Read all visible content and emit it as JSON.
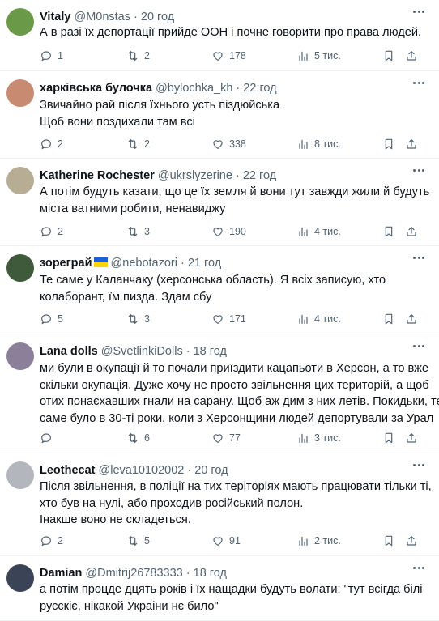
{
  "posts": [
    {
      "name": "Vitaly",
      "handle": "@M0nstas",
      "time": "20 год",
      "lines": [
        "А в разі їх депортації прийде ООН і почне говорити про права людей."
      ],
      "replies": "1",
      "reposts": "2",
      "likes": "178",
      "views": "5 тис.",
      "avatar_color": "#6a9a48"
    },
    {
      "name": "харківська булочка",
      "handle": "@bylochka_kh",
      "time": "22 год",
      "lines": [
        "Звичайно рай після їхнього усть піздюйська",
        "Щоб вони поздихали там всі"
      ],
      "replies": "2",
      "reposts": "2",
      "likes": "338",
      "views": "8 тис.",
      "avatar_color": "#c98a72"
    },
    {
      "name": "Katherine Rochester",
      "handle": "@ukrslyzerine",
      "time": "22 год",
      "lines": [
        "А потім будуть казати, що це їх земля й вони тут завжди жили й будуть",
        "міста ватними робити, ненавиджу"
      ],
      "replies": "2",
      "reposts": "3",
      "likes": "190",
      "views": "4 тис.",
      "avatar_color": "#b7ad95"
    },
    {
      "name": "зореграй",
      "handle": "@nebotazori",
      "time": "21 год",
      "lines": [
        "Те саме у Каланчаку (херсонська область). Я всіх записую, хто",
        "колаборант, їм пизда. Здам сбу"
      ],
      "replies": "5",
      "reposts": "3",
      "likes": "171",
      "views": "4 тис.",
      "avatar_color": "#3f5a3a",
      "flag": [
        "#1f5fd6",
        "#ffd400"
      ]
    },
    {
      "name": "Lana dolls",
      "handle": "@SvetlinkiDolls",
      "time": "18 год",
      "lines": [
        "ми були в окупації й то почали приїздити кацапьоти в Херсон, а то вже",
        "скільки окупація. Дуже хочу не просто звільнення цих територій, а щоб",
        "отих понаєхавших гнали на сарану. Щоб аж дим з них летів. Покидьки, те",
        "саме було в 30-ті роки, коли з Херсонщини людей депортували за Урал"
      ],
      "replies": "",
      "reposts": "6",
      "likes": "77",
      "views": "3 тис.",
      "avatar_color": "#8c7f9a"
    },
    {
      "name": "Leothecat",
      "handle": "@leva10102002",
      "time": "20 год",
      "lines": [
        "Після звільнення, в поліції на тих теріторіях мають працювати тільки ті,",
        "хто був на нулі, або проходив російський полон.",
        "Інакше воно не складеться."
      ],
      "replies": "2",
      "reposts": "5",
      "likes": "91",
      "views": "2 тис.",
      "avatar_color": "#b3b7bd"
    },
    {
      "name": "Damian",
      "handle": "@Dmitrij26783333",
      "time": "18 год",
      "lines": [
        "а потім процде дцять років і їх нащадки будуть волати: \"тут всігда білі",
        "русскіє, нікакой Украіни нє било\""
      ],
      "avatar_color": "#3b4456"
    }
  ]
}
